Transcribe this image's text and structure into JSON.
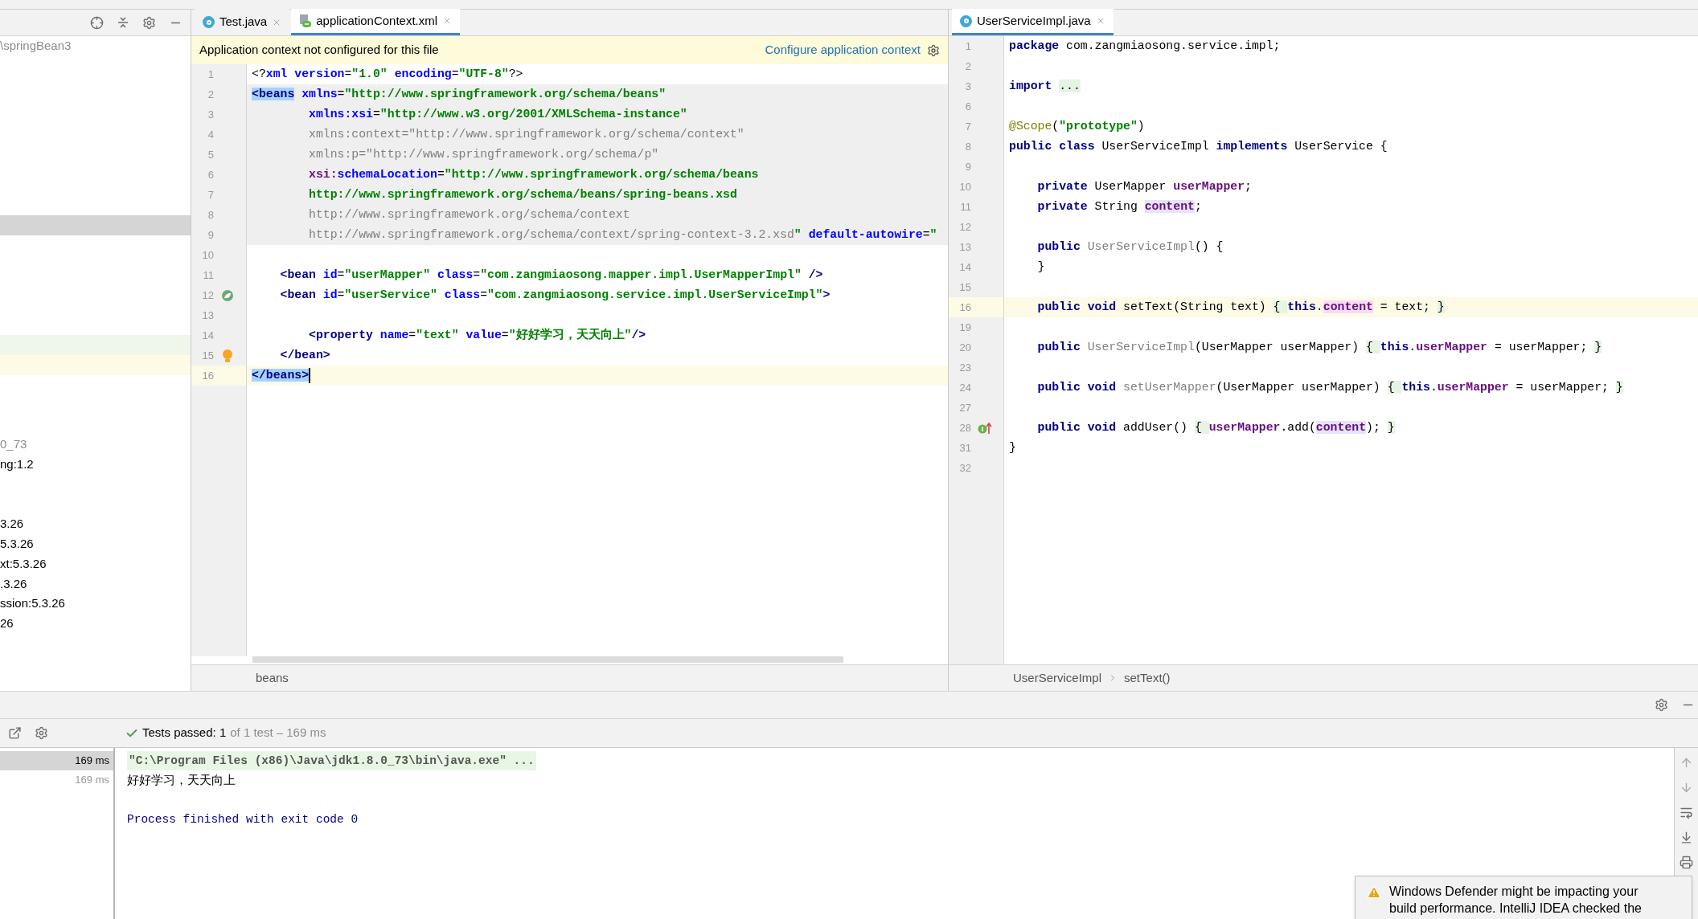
{
  "project_panel": {
    "tree": [
      {
        "label": "\\springBean3",
        "dim": true
      },
      {
        "label": "0_73",
        "dim": true
      },
      {
        "label": "ng:1.2",
        "dim": false
      },
      {
        "label": "3.26",
        "dim": false
      },
      {
        "label": "5.3.26",
        "dim": false
      },
      {
        "label": "xt:5.3.26",
        "dim": false
      },
      {
        "label": ".3.26",
        "dim": false
      },
      {
        "label": "ssion:5.3.26",
        "dim": false
      },
      {
        "label": "26",
        "dim": false
      }
    ]
  },
  "xml_editor": {
    "tabs": [
      {
        "label": "Test.java",
        "kind": "java",
        "selected": false
      },
      {
        "label": "applicationContext.xml",
        "kind": "xml",
        "selected": true
      }
    ],
    "banner": {
      "message": "Application context not configured for this file",
      "link": "Configure application context"
    },
    "lines": [
      {
        "number": "1",
        "highlighted": false,
        "current": false,
        "tokens": [
          {
            "kind": "plain",
            "text": "<?"
          },
          {
            "kind": "attr",
            "text": "xml"
          },
          {
            "kind": "attr",
            "text": " version"
          },
          {
            "kind": "plain",
            "text": "="
          },
          {
            "kind": "value",
            "text": "\"1.0\""
          },
          {
            "kind": "attr",
            "text": " encoding"
          },
          {
            "kind": "plain",
            "text": "="
          },
          {
            "kind": "value",
            "text": "\"UTF-8\""
          },
          {
            "kind": "plain",
            "text": "?>"
          }
        ]
      },
      {
        "number": "2",
        "highlighted": true,
        "current": false,
        "tokens": [
          {
            "kind": "tag_match",
            "text": "<beans"
          },
          {
            "kind": "attr",
            "text": " xmlns"
          },
          {
            "kind": "plain",
            "text": "="
          },
          {
            "kind": "value",
            "text": "\"http://www.springframework.org/schema/beans\""
          }
        ]
      },
      {
        "number": "3",
        "highlighted": true,
        "current": false,
        "tokens": [
          {
            "kind": "attr",
            "text": "        xmlns:xsi"
          },
          {
            "kind": "plain",
            "text": "="
          },
          {
            "kind": "value",
            "text": "\"http://www.w3.org/2001/XMLSchema-instance\""
          }
        ]
      },
      {
        "number": "4",
        "highlighted": true,
        "current": false,
        "tokens": [
          {
            "kind": "unused",
            "text": "        xmlns:context=\"http://www.springframework.org/schema/context\""
          }
        ]
      },
      {
        "number": "5",
        "highlighted": true,
        "current": false,
        "tokens": [
          {
            "kind": "unused",
            "text": "        xmlns:p=\"http://www.springframework.org/schema/p\""
          }
        ]
      },
      {
        "number": "6",
        "highlighted": true,
        "current": false,
        "tokens": [
          {
            "kind": "ns",
            "text": "        xsi:"
          },
          {
            "kind": "attr",
            "text": "schemaLocation"
          },
          {
            "kind": "plain",
            "text": "="
          },
          {
            "kind": "value",
            "text": "\"http://www.springframework.org/schema/beans"
          }
        ]
      },
      {
        "number": "7",
        "highlighted": true,
        "current": false,
        "tokens": [
          {
            "kind": "value",
            "text": "        http://www.springframework.org/schema/beans/spring-beans.xsd"
          }
        ]
      },
      {
        "number": "8",
        "highlighted": true,
        "current": false,
        "tokens": [
          {
            "kind": "unused",
            "text": "        http://www.springframework.org/schema/context"
          }
        ]
      },
      {
        "number": "9",
        "highlighted": true,
        "current": false,
        "tokens": [
          {
            "kind": "unused",
            "text": "        http://www.springframework.org/schema/context/spring-context-3.2.xsd"
          },
          {
            "kind": "value",
            "text": "\""
          },
          {
            "kind": "attr",
            "text": " default-autowire"
          },
          {
            "kind": "plain",
            "text": "="
          },
          {
            "kind": "value",
            "text": "\""
          }
        ]
      },
      {
        "number": "10",
        "highlighted": false,
        "current": false
      },
      {
        "number": "11",
        "highlighted": false,
        "current": false,
        "tokens": [
          {
            "kind": "tag",
            "text": "    <bean"
          },
          {
            "kind": "attr",
            "text": " id"
          },
          {
            "kind": "plain",
            "text": "="
          },
          {
            "kind": "value",
            "text": "\"userMapper\""
          },
          {
            "kind": "attr",
            "text": " class"
          },
          {
            "kind": "plain",
            "text": "="
          },
          {
            "kind": "value",
            "text": "\"com.zangmiaosong.mapper.impl.UserMapperImpl\""
          },
          {
            "kind": "tag",
            "text": " />"
          }
        ]
      },
      {
        "number": "12",
        "highlighted": false,
        "current": false,
        "gutter": {
          "kind": "bean"
        },
        "tokens": [
          {
            "kind": "tag",
            "text": "    <bean"
          },
          {
            "kind": "attr",
            "text": " id"
          },
          {
            "kind": "plain",
            "text": "="
          },
          {
            "kind": "value",
            "text": "\"userService\""
          },
          {
            "kind": "attr",
            "text": " class"
          },
          {
            "kind": "plain",
            "text": "="
          },
          {
            "kind": "value",
            "text": "\"com.zangmiaosong.service.impl.UserServiceImpl\""
          },
          {
            "kind": "tag",
            "text": ">"
          }
        ]
      },
      {
        "number": "13",
        "highlighted": false,
        "current": false
      },
      {
        "number": "14",
        "highlighted": false,
        "current": false,
        "tokens": [
          {
            "kind": "tag",
            "text": "        <property"
          },
          {
            "kind": "attr",
            "text": " name"
          },
          {
            "kind": "plain",
            "text": "="
          },
          {
            "kind": "value",
            "text": "\"text\""
          },
          {
            "kind": "attr",
            "text": " value"
          },
          {
            "kind": "plain",
            "text": "="
          },
          {
            "kind": "value",
            "text": "\"好好学习，天天向上\""
          },
          {
            "kind": "tag",
            "text": "/>"
          }
        ]
      },
      {
        "number": "15",
        "highlighted": false,
        "current": false,
        "gutter": {
          "kind": "bulb"
        },
        "tokens": [
          {
            "kind": "tag",
            "text": "    </bean>"
          }
        ]
      },
      {
        "number": "16",
        "highlighted": false,
        "current": true,
        "tokens": [
          {
            "kind": "tag_match",
            "text": "</beans>"
          }
        ]
      }
    ],
    "breadcrumbs": [
      "beans"
    ]
  },
  "java_editor": {
    "tabs": [
      {
        "label": "UserServiceImpl.java",
        "kind": "java",
        "selected": true
      }
    ],
    "lines": [
      {
        "number": "1",
        "current": false,
        "tokens": [
          {
            "kind": "kw",
            "text": "package"
          },
          {
            "kind": "plain",
            "text": " com.zangmiaosong.service.impl;"
          }
        ]
      },
      {
        "number": "2",
        "current": false
      },
      {
        "number": "3",
        "current": false,
        "tokens": [
          {
            "kind": "kw",
            "text": "import "
          },
          {
            "kind": "folded",
            "text": "..."
          }
        ]
      },
      {
        "number": "6",
        "current": false
      },
      {
        "number": "7",
        "current": false,
        "tokens": [
          {
            "kind": "annot",
            "text": "@Scope"
          },
          {
            "kind": "plain",
            "text": "("
          },
          {
            "kind": "str",
            "text": "\"prototype\""
          },
          {
            "kind": "plain",
            "text": ")"
          }
        ]
      },
      {
        "number": "8",
        "current": false,
        "tokens": [
          {
            "kind": "kw",
            "text": "public class"
          },
          {
            "kind": "plain",
            "text": " UserServiceImpl "
          },
          {
            "kind": "kw",
            "text": "implements"
          },
          {
            "kind": "plain",
            "text": " UserService {"
          }
        ]
      },
      {
        "number": "9",
        "current": false
      },
      {
        "number": "10",
        "current": false,
        "tokens": [
          {
            "kind": "kw",
            "text": "    private"
          },
          {
            "kind": "plain",
            "text": " UserMapper "
          },
          {
            "kind": "field",
            "text": "userMapper"
          },
          {
            "kind": "plain",
            "text": ";"
          }
        ]
      },
      {
        "number": "11",
        "current": false,
        "tokens": [
          {
            "kind": "kw",
            "text": "    private"
          },
          {
            "kind": "plain",
            "text": " String "
          },
          {
            "kind": "field_usage",
            "text": "content"
          },
          {
            "kind": "plain",
            "text": ";"
          }
        ]
      },
      {
        "number": "12",
        "current": false
      },
      {
        "number": "13",
        "current": false,
        "tokens": [
          {
            "kind": "kw",
            "text": "    public "
          },
          {
            "kind": "unused",
            "text": "UserServiceImpl"
          },
          {
            "kind": "plain",
            "text": "() {"
          }
        ]
      },
      {
        "number": "14",
        "current": false,
        "tokens": [
          {
            "kind": "plain",
            "text": "    }"
          }
        ]
      },
      {
        "number": "15",
        "current": false
      },
      {
        "number": "16",
        "current": true,
        "tokens": [
          {
            "kind": "kw",
            "text": "    public void"
          },
          {
            "kind": "plain",
            "text": " setText(String text) "
          },
          {
            "kind": "folded",
            "text": "{ "
          },
          {
            "kind": "kw",
            "text": "this"
          },
          {
            "kind": "plain",
            "text": "."
          },
          {
            "kind": "field_write",
            "text": "content"
          },
          {
            "kind": "plain",
            "text": " = text; "
          },
          {
            "kind": "folded",
            "text": "}"
          }
        ]
      },
      {
        "number": "19",
        "current": false
      },
      {
        "number": "20",
        "current": false,
        "tokens": [
          {
            "kind": "kw",
            "text": "    public "
          },
          {
            "kind": "unused",
            "text": "UserServiceImpl"
          },
          {
            "kind": "plain",
            "text": "(UserMapper userMapper) "
          },
          {
            "kind": "folded",
            "text": "{ "
          },
          {
            "kind": "kw",
            "text": "this"
          },
          {
            "kind": "plain",
            "text": "."
          },
          {
            "kind": "field",
            "text": "userMapper"
          },
          {
            "kind": "plain",
            "text": " = userMapper; "
          },
          {
            "kind": "folded",
            "text": "}"
          }
        ]
      },
      {
        "number": "23",
        "current": false
      },
      {
        "number": "24",
        "current": false,
        "tokens": [
          {
            "kind": "kw",
            "text": "    public void "
          },
          {
            "kind": "unused",
            "text": "setUserMapper"
          },
          {
            "kind": "plain",
            "text": "(UserMapper userMapper) "
          },
          {
            "kind": "folded",
            "text": "{ "
          },
          {
            "kind": "kw",
            "text": "this"
          },
          {
            "kind": "plain",
            "text": "."
          },
          {
            "kind": "field",
            "text": "userMapper"
          },
          {
            "kind": "plain",
            "text": " = userMapper; "
          },
          {
            "kind": "folded",
            "text": "}"
          }
        ]
      },
      {
        "number": "27",
        "current": false
      },
      {
        "number": "28",
        "current": false,
        "gutter": {
          "kind": "implements"
        },
        "tokens": [
          {
            "kind": "kw",
            "text": "    public void"
          },
          {
            "kind": "plain",
            "text": " addUser() "
          },
          {
            "kind": "folded",
            "text": "{ "
          },
          {
            "kind": "field",
            "text": "userMapper"
          },
          {
            "kind": "plain",
            "text": ".add("
          },
          {
            "kind": "field_usage",
            "text": "content"
          },
          {
            "kind": "plain",
            "text": "); "
          },
          {
            "kind": "folded",
            "text": "}"
          }
        ]
      },
      {
        "number": "31",
        "current": false,
        "tokens": [
          {
            "kind": "plain",
            "text": "}"
          }
        ]
      },
      {
        "number": "32",
        "current": false
      }
    ],
    "breadcrumbs": [
      "UserServiceImpl",
      "setText()"
    ]
  },
  "run_panel": {
    "status": {
      "passed": "Tests passed: 1",
      "detail": "of 1 test – 169 ms"
    },
    "tests": [
      {
        "duration": "169 ms",
        "selected": true
      },
      {
        "duration": "169 ms",
        "selected": false
      }
    ],
    "console": [
      {
        "kind": "command",
        "text": "\"C:\\Program Files (x86)\\Java\\jdk1.8.0_73\\bin\\java.exe\" ..."
      },
      {
        "kind": "output",
        "text": "好好学习，天天向上"
      },
      {
        "kind": "system",
        "text": "Process finished with exit code 0"
      }
    ]
  },
  "notification": {
    "text": "Windows Defender might be impacting your build performance. IntelliJ IDEA checked the"
  }
}
